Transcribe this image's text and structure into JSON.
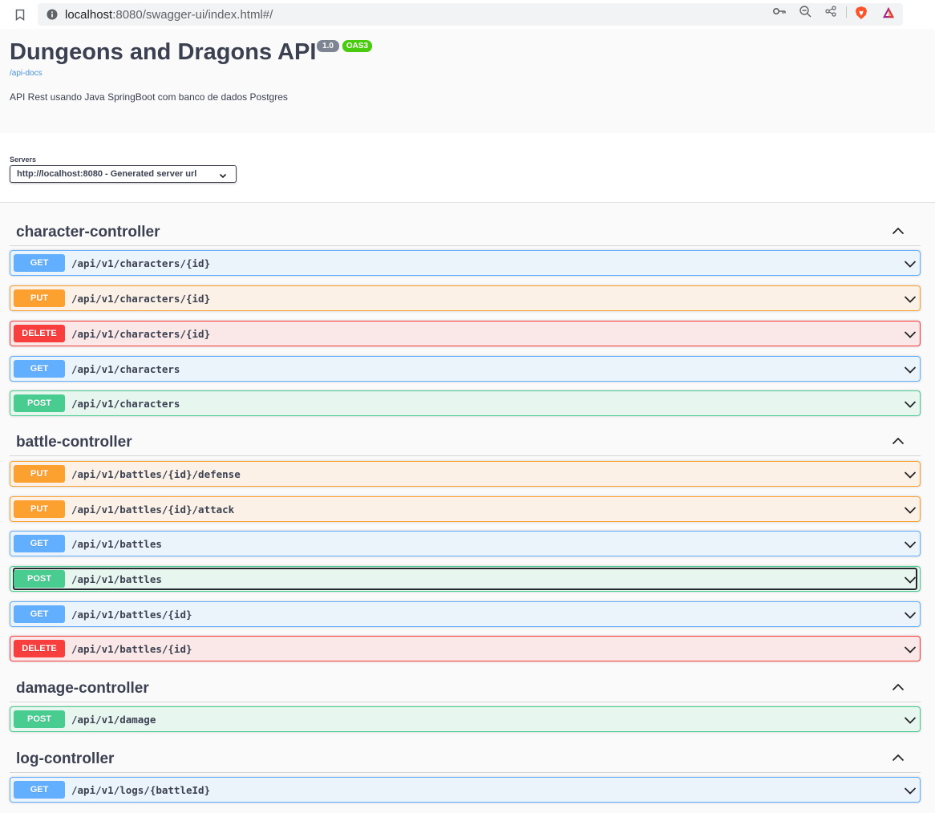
{
  "browser": {
    "url_host": "localhost",
    "url_rest": ":8080/swagger-ui/index.html#/"
  },
  "info": {
    "title": "Dungeons and Dragons API",
    "version": "1.0",
    "oas_badge": "OAS3",
    "docs_link": "/api-docs",
    "description": "API Rest usando Java SpringBoot com banco de dados Postgres"
  },
  "servers": {
    "label": "Servers",
    "selected": "http://localhost:8080 - Generated server url"
  },
  "tags": [
    {
      "name": "character-controller",
      "operations": [
        {
          "method": "GET",
          "path": "/api/v1/characters/{id}"
        },
        {
          "method": "PUT",
          "path": "/api/v1/characters/{id}"
        },
        {
          "method": "DELETE",
          "path": "/api/v1/characters/{id}"
        },
        {
          "method": "GET",
          "path": "/api/v1/characters"
        },
        {
          "method": "POST",
          "path": "/api/v1/characters"
        }
      ]
    },
    {
      "name": "battle-controller",
      "operations": [
        {
          "method": "PUT",
          "path": "/api/v1/battles/{id}/defense"
        },
        {
          "method": "PUT",
          "path": "/api/v1/battles/{id}/attack"
        },
        {
          "method": "GET",
          "path": "/api/v1/battles"
        },
        {
          "method": "POST",
          "path": "/api/v1/battles"
        },
        {
          "method": "GET",
          "path": "/api/v1/battles/{id}"
        },
        {
          "method": "DELETE",
          "path": "/api/v1/battles/{id}"
        }
      ]
    },
    {
      "name": "damage-controller",
      "operations": [
        {
          "method": "POST",
          "path": "/api/v1/damage"
        }
      ]
    },
    {
      "name": "log-controller",
      "operations": [
        {
          "method": "GET",
          "path": "/api/v1/logs/{battleId}"
        }
      ]
    }
  ],
  "colors": {
    "get": "#61affe",
    "put": "#fca130",
    "delete": "#f93e3e",
    "post": "#49cc90",
    "badge_version": "#7d8492",
    "badge_oas": "#49cc0f",
    "link": "#4990e2"
  }
}
